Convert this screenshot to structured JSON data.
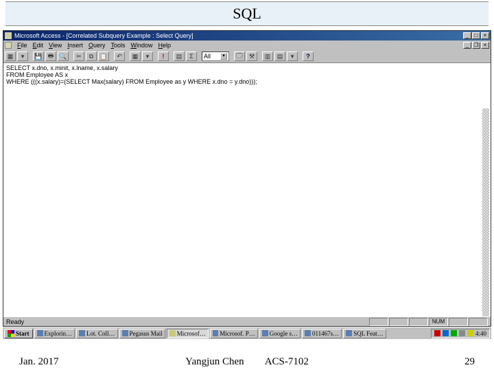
{
  "slide": {
    "title": "SQL",
    "date": "Jan. 2017",
    "author": "Yangjun Chen",
    "course": "ACS-7102",
    "page": "29"
  },
  "window": {
    "title": "Microsoft Access - [Correlated Subquery Example : Select Query]"
  },
  "menu": {
    "file": "File",
    "edit": "Edit",
    "view": "View",
    "insert": "Insert",
    "query": "Query",
    "tools": "Tools",
    "window": "Window",
    "help": "Help"
  },
  "toolbar": {
    "combo_value": "All"
  },
  "sql": {
    "line1": "SELECT x.dno, x.minit, x.lname, x.salary",
    "line2": "FROM Employee AS x",
    "line3": "WHERE (((x.salary)=(SELECT Max(salary) FROM Employee as y WHERE x.dno = y.dno)));"
  },
  "status": {
    "ready": "Ready",
    "num": "NUM"
  },
  "taskbar": {
    "start": "Start",
    "items": [
      "Explorin…",
      "Lot. Coll…",
      "Pegasus Mail",
      "Microsof…",
      "Microsof. P…",
      "Google s…",
      "011467s…",
      "SQL Feat…"
    ],
    "time": "4:40"
  }
}
